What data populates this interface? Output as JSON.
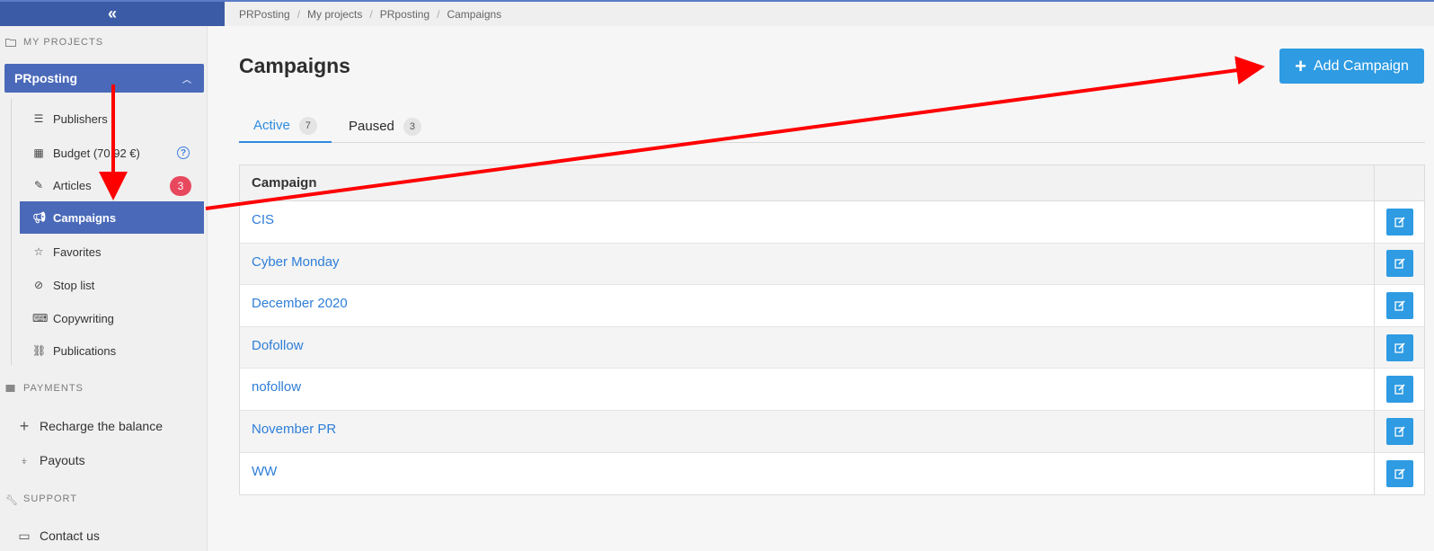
{
  "sidebar": {
    "collapse_label": "«",
    "my_projects_title": "MY PROJECTS",
    "project_name": "PRposting",
    "items": [
      {
        "label": "Publishers",
        "icon": "list-icon"
      },
      {
        "label": "Budget (70.92 €)",
        "icon": "calculator-icon"
      },
      {
        "label": "Articles",
        "icon": "pencil-icon",
        "badge": "3"
      },
      {
        "label": "Campaigns",
        "icon": "megaphone-icon",
        "active": true
      },
      {
        "label": "Favorites",
        "icon": "star-icon"
      },
      {
        "label": "Stop list",
        "icon": "ban-icon"
      },
      {
        "label": "Copywriting",
        "icon": "keyboard-icon"
      },
      {
        "label": "Publications",
        "icon": "network-icon"
      }
    ],
    "payments_title": "PAYMENTS",
    "payments_items": [
      {
        "label": "Recharge the balance",
        "icon": "plus-icon"
      },
      {
        "label": "Payouts",
        "icon": "hand-coin-icon"
      }
    ],
    "support_title": "SUPPORT",
    "support_items": [
      {
        "label": "Contact us",
        "icon": "chat-icon"
      }
    ]
  },
  "breadcrumb": [
    "PRPosting",
    "My projects",
    "PRposting",
    "Campaigns"
  ],
  "page": {
    "title": "Campaigns",
    "add_button_label": "Add Campaign"
  },
  "tabs": [
    {
      "label": "Active",
      "count": "7",
      "active": true
    },
    {
      "label": "Paused",
      "count": "3",
      "active": false
    }
  ],
  "table": {
    "header": "Campaign",
    "rows": [
      "CIS",
      "Cyber Monday",
      "December 2020",
      "Dofollow",
      "nofollow",
      "November PR",
      "WW"
    ]
  },
  "colors": {
    "accent": "#4a69b9",
    "button": "#2e9be3",
    "link": "#2e7ed8",
    "badge": "#e8485e",
    "annotation_arrow": "#ff0000"
  }
}
